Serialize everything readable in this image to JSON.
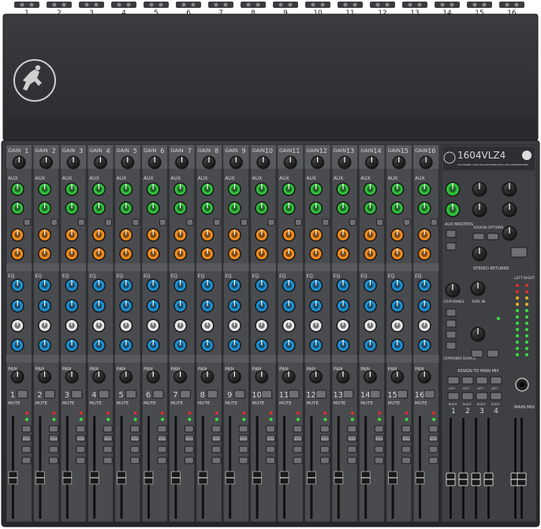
{
  "mixer": {
    "model": "1604VLZ4",
    "subtitle": "16-CHANNEL 4-BUS MIC/LINE MIXER WITH ONYX PREAMPLIFIERS",
    "brand_logo": "running-man-logo",
    "colors": {
      "body": "#2b2c2f",
      "panel": "#3a3b3f",
      "channel_strip": "#4a4b4f",
      "aux_green": "#2fbf3a",
      "aux_orange": "#f08a1c",
      "eq_blue": "#1d8fd0",
      "eq_white": "#e6e6e6",
      "knob_dark": "#1b1b1c",
      "led_green": "#38e03f",
      "led_red": "#e0302a",
      "led_amber": "#e6b21f"
    }
  },
  "top_panel": {
    "rear_jack_numbers": [
      "1",
      "2",
      "3",
      "4",
      "5",
      "6",
      "7",
      "8",
      "9",
      "10",
      "11",
      "12",
      "13",
      "14",
      "15",
      "16"
    ]
  },
  "channels": {
    "gain_label": "GAIN",
    "aux_label": "AUX",
    "eq_label": "EQ",
    "pan_label": "PAN",
    "mute_label": "MUTE",
    "solo_label": "SOLO",
    "numbers": [
      "1",
      "2",
      "3",
      "4",
      "5",
      "6",
      "7",
      "8",
      "9",
      "10",
      "11",
      "12",
      "13",
      "14",
      "15",
      "16"
    ]
  },
  "master_section": {
    "aux_masters_label": "AUX MASTERS",
    "stereo_returns_label": "STEREO RETURNS",
    "assign_options_label": "ASSIGN OPTIONS",
    "phones_label": "CR/PHONES",
    "tape_in_label": "TAPE IN",
    "source_label": "CR/PHONES SOURCE",
    "assign_to_main_mix_label": "ASSIGN TO MAIN MIX",
    "main_mix_label": "MAIN MIX",
    "meter_left_label": "LEFT",
    "meter_right_label": "RIGHT",
    "sub_labels": [
      "1",
      "2",
      "3",
      "4"
    ],
    "sub_side_labels": [
      "LEFT",
      "RIGHT",
      "LEFT",
      "RIGHT",
      "LEFT",
      "RIGHT",
      "LEFT",
      "RIGHT"
    ]
  }
}
